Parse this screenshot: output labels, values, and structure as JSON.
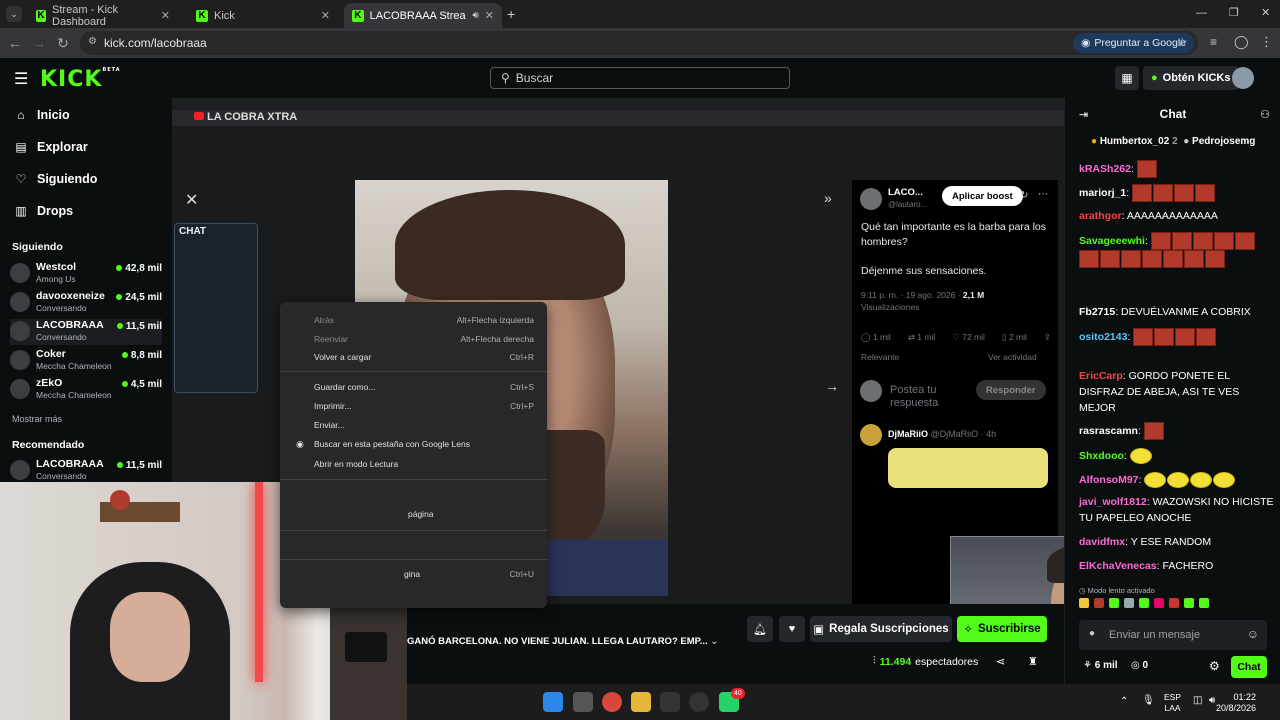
{
  "browser": {
    "tabs": [
      {
        "title": "Stream - Kick Dashboard"
      },
      {
        "title": "Kick"
      },
      {
        "title": "LACOBRAAA Stream - Watc"
      }
    ],
    "url": "kick.com/lacobraaa",
    "google_ask": "Preguntar a Google"
  },
  "header": {
    "logo": "KICK",
    "logo_badge": "BETA",
    "search_placeholder": "Buscar",
    "kicks_button": "Obtén KICKs"
  },
  "sidebar": {
    "nav": [
      {
        "label": "Inicio",
        "icon": "home-icon"
      },
      {
        "label": "Explorar",
        "icon": "compass-icon"
      },
      {
        "label": "Siguiendo",
        "icon": "heart-icon"
      },
      {
        "label": "Drops",
        "icon": "drops-icon"
      }
    ],
    "following_title": "Siguiendo",
    "following": [
      {
        "name": "Westcol",
        "game": "Among Us",
        "viewers": "42,8 mil"
      },
      {
        "name": "davooxeneize",
        "game": "Conversando",
        "viewers": "24,5 mil"
      },
      {
        "name": "LACOBRAAA",
        "game": "Conversando",
        "viewers": "11,5 mil"
      },
      {
        "name": "Coker",
        "game": "Meccha Chameleon",
        "viewers": "8,8 mil"
      },
      {
        "name": "zEkO",
        "game": "Meccha Chameleon",
        "viewers": "4,5 mil"
      }
    ],
    "show_more": "Mostrar más",
    "recommended_title": "Recomendado",
    "recommended": [
      {
        "name": "LACOBRAAA",
        "game": "Conversando",
        "viewers": "11,5 mil"
      }
    ]
  },
  "video": {
    "overlay_title": "LA COBRA XTRA",
    "overlay_chat_label": "CHAT",
    "tweet": {
      "author": "LACO...",
      "handle": "@lautaro...",
      "boost_button": "Aplicar boost",
      "text1": "Qué tan importante es la barba para los hombres?",
      "text2": "Déjenme sus sensaciones.",
      "meta": "9:11 p. m. · 19 ago. 2026 · ",
      "views_count": "2,1 M",
      "views_label": "Visualizaciones",
      "replies": "1 mil",
      "retweets": "1 mil",
      "likes": "72 mil",
      "bookmarks": "2 mil",
      "relevant": "Relevante",
      "see_activity": "Ver actividad",
      "reply_placeholder": "Postea tu respuesta",
      "reply_button": "Responder",
      "second_author": "DjMaRiiO",
      "second_handle": "@DjMaRiiO · 4h"
    },
    "photo_stat": "2 M",
    "context_menu": [
      {
        "label": "Atrás",
        "shortcut": "Alt+Flecha izquierda",
        "disabled": true
      },
      {
        "label": "Reenviar",
        "shortcut": "Alt+Flecha derecha",
        "disabled": true
      },
      {
        "label": "Volver a cargar",
        "shortcut": "Ctrl+R",
        "disabled": false
      },
      {
        "label": "Guardar como...",
        "shortcut": "Ctrl+S",
        "disabled": false
      },
      {
        "label": "Imprimir...",
        "shortcut": "Ctrl+P",
        "disabled": false
      },
      {
        "label": "Enviar...",
        "shortcut": "",
        "disabled": false
      },
      {
        "label": "Buscar en esta pestaña con Google Lens",
        "shortcut": "",
        "disabled": false
      },
      {
        "label": "Abrir en modo Lectura",
        "shortcut": "",
        "disabled": false
      },
      {
        "label": "página",
        "shortcut": "",
        "disabled": false
      },
      {
        "label": "gina",
        "shortcut": "Ctrl+U",
        "disabled": false
      }
    ]
  },
  "below": {
    "stream_title": "GANÓ BARCELONA. NO VIENE JULIAN. LLEGA LAUTARO? EMP...",
    "gift_button": "Regala Suscripciones",
    "subscribe_button": "Suscribirse",
    "viewer_count": "11.494",
    "viewer_label": "espectadores"
  },
  "chat": {
    "title": "Chat",
    "top_users": [
      "Humbertox_02",
      "2",
      "Pedrojosemg"
    ],
    "messages": [
      {
        "user": "kRASh262",
        "color": "#ff6bd6",
        "text": "",
        "emotes": 1,
        "emote_type": "r"
      },
      {
        "user": "mariorj_1",
        "color": "#ffffff",
        "text": "",
        "emotes": 4,
        "emote_type": "r"
      },
      {
        "user": "arathgor",
        "color": "#ff4040",
        "text": "AAAAAAAAAAAAA",
        "emotes": 0,
        "emote_type": "r"
      },
      {
        "user": "Savageeewhi",
        "color": "#53fc18",
        "text": "",
        "emotes": 3,
        "emote_type": "r"
      },
      {
        "user": "Fb2715",
        "color": "#ffffff",
        "text": "DEVUÉLVANME A COBRIX",
        "emotes": 0,
        "emote_type": "r"
      },
      {
        "user": "osito2143",
        "color": "#53c8ff",
        "text": "",
        "emotes": 4,
        "emote_type": "r"
      },
      {
        "user": "EricCarp",
        "color": "#ff4040",
        "text": "GORDO PONETE EL DISFRAZ DE ABEJA, ASI TE VES MEJOR",
        "emotes": 0,
        "emote_type": "r"
      },
      {
        "user": "rasrascamn",
        "color": "#ffffff",
        "text": "",
        "emotes": 1,
        "emote_type": "r"
      },
      {
        "user": "Shxdooo",
        "color": "#53fc18",
        "text": "",
        "emotes": 1,
        "emote_type": "y"
      },
      {
        "user": "AlfonsoM97",
        "color": "#ff6bd6",
        "text": "",
        "emotes": 4,
        "emote_type": "y"
      },
      {
        "user": "javi_wolf1812",
        "color": "#ff6bd6",
        "text": "WAZOWSKI NO HICISTE TU PAPELEO ANOCHE",
        "emotes": 0,
        "emote_type": "r"
      },
      {
        "user": "davidfmx",
        "color": "#ff6bd6",
        "text": "Y ESE RANDOM",
        "emotes": 0,
        "emote_type": "r"
      },
      {
        "user": "ElKchaVenecas",
        "color": "#ff6bd6",
        "text": "FACHERO",
        "emotes": 0,
        "emote_type": "r"
      }
    ],
    "slow_mode": "Modo lento activado",
    "input_placeholder": "Enviar un mensaje",
    "kicks_count": "6 mil",
    "points": "0",
    "chat_button": "Chat"
  },
  "taskbar": {
    "lang": "ESP",
    "lang2": "LAA",
    "time": "01:22",
    "date": "20/8/2026",
    "badge_count": "40"
  }
}
